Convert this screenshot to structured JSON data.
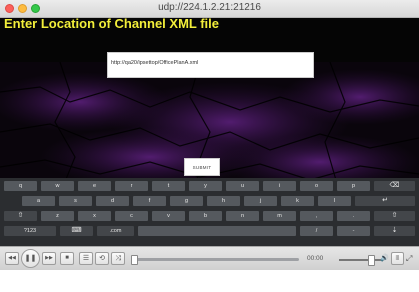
{
  "window": {
    "title": "udp://224.1.2.21:21216"
  },
  "page": {
    "heading": "Enter Location of Channel XML file",
    "url_value": "http://qa20/ipsettop/OfficePlanA.xml",
    "submit_label": "SUBMIT"
  },
  "keyboard": {
    "row1": [
      "q",
      "w",
      "e",
      "r",
      "t",
      "y",
      "u",
      "i",
      "o",
      "p"
    ],
    "row2": [
      "a",
      "s",
      "d",
      "f",
      "g",
      "h",
      "j",
      "k",
      "l"
    ],
    "row3": [
      "z",
      "x",
      "c",
      "v",
      "b",
      "n",
      "m",
      ",",
      "."
    ],
    "backspace": "⌫",
    "enter": "↵",
    "shift": "⇧",
    "shift_right": "⇧",
    "sym": "?123",
    "keyboard_icon": "⌨",
    "dotcom": ".com",
    "slash": "/",
    "dash": "-",
    "hide": "⇣"
  },
  "player": {
    "time": "00:00",
    "prev_icon": "◀◀",
    "play_icon": "❚❚",
    "next_icon": "▶▶",
    "stop_icon": "■",
    "playlist_icon": "☰",
    "loop_icon": "⟲",
    "shuffle_icon": "⤨",
    "volume_icon": "🔊",
    "ext_icon": "|||",
    "fullscreen_icon": "⤢"
  }
}
